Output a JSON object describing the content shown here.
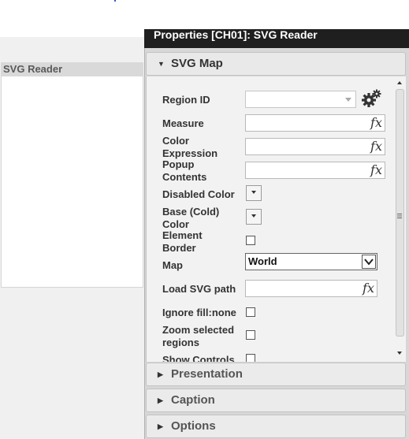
{
  "panel": {
    "title": "Properties [CH01]: SVG Reader"
  },
  "canvas": {
    "object_caption": "SVG Reader"
  },
  "sections": {
    "svg_map": "SVG Map",
    "presentation": "Presentation",
    "caption": "Caption",
    "options": "Options"
  },
  "props": {
    "region_id": "Region ID",
    "measure": "Measure",
    "color_expression": [
      "Color",
      "Expression"
    ],
    "popup_contents": [
      "Popup",
      "Contents"
    ],
    "disabled_color": "Disabled Color",
    "base_cold_color": [
      "Base (Cold)",
      "Color"
    ],
    "element_border": [
      "Element",
      "Border"
    ],
    "map": "Map",
    "map_value": "World",
    "load_svg_path": "Load SVG path",
    "ignore_fill_none": "Ignore fill:none",
    "zoom_selected_regions": [
      "Zoom selected",
      "regions"
    ],
    "show_controls": "Show Controls"
  },
  "fx_label": "fx",
  "icons": {
    "gear": "gear-icon",
    "expand": "triangle-right-icon",
    "collapse": "triangle-down-icon"
  },
  "colors": {
    "title_bar": "#1f1f1f",
    "panel_bg": "#d7d7d7",
    "section_bg": "#ebebeb",
    "caption_bg": "#d9d9d9"
  }
}
